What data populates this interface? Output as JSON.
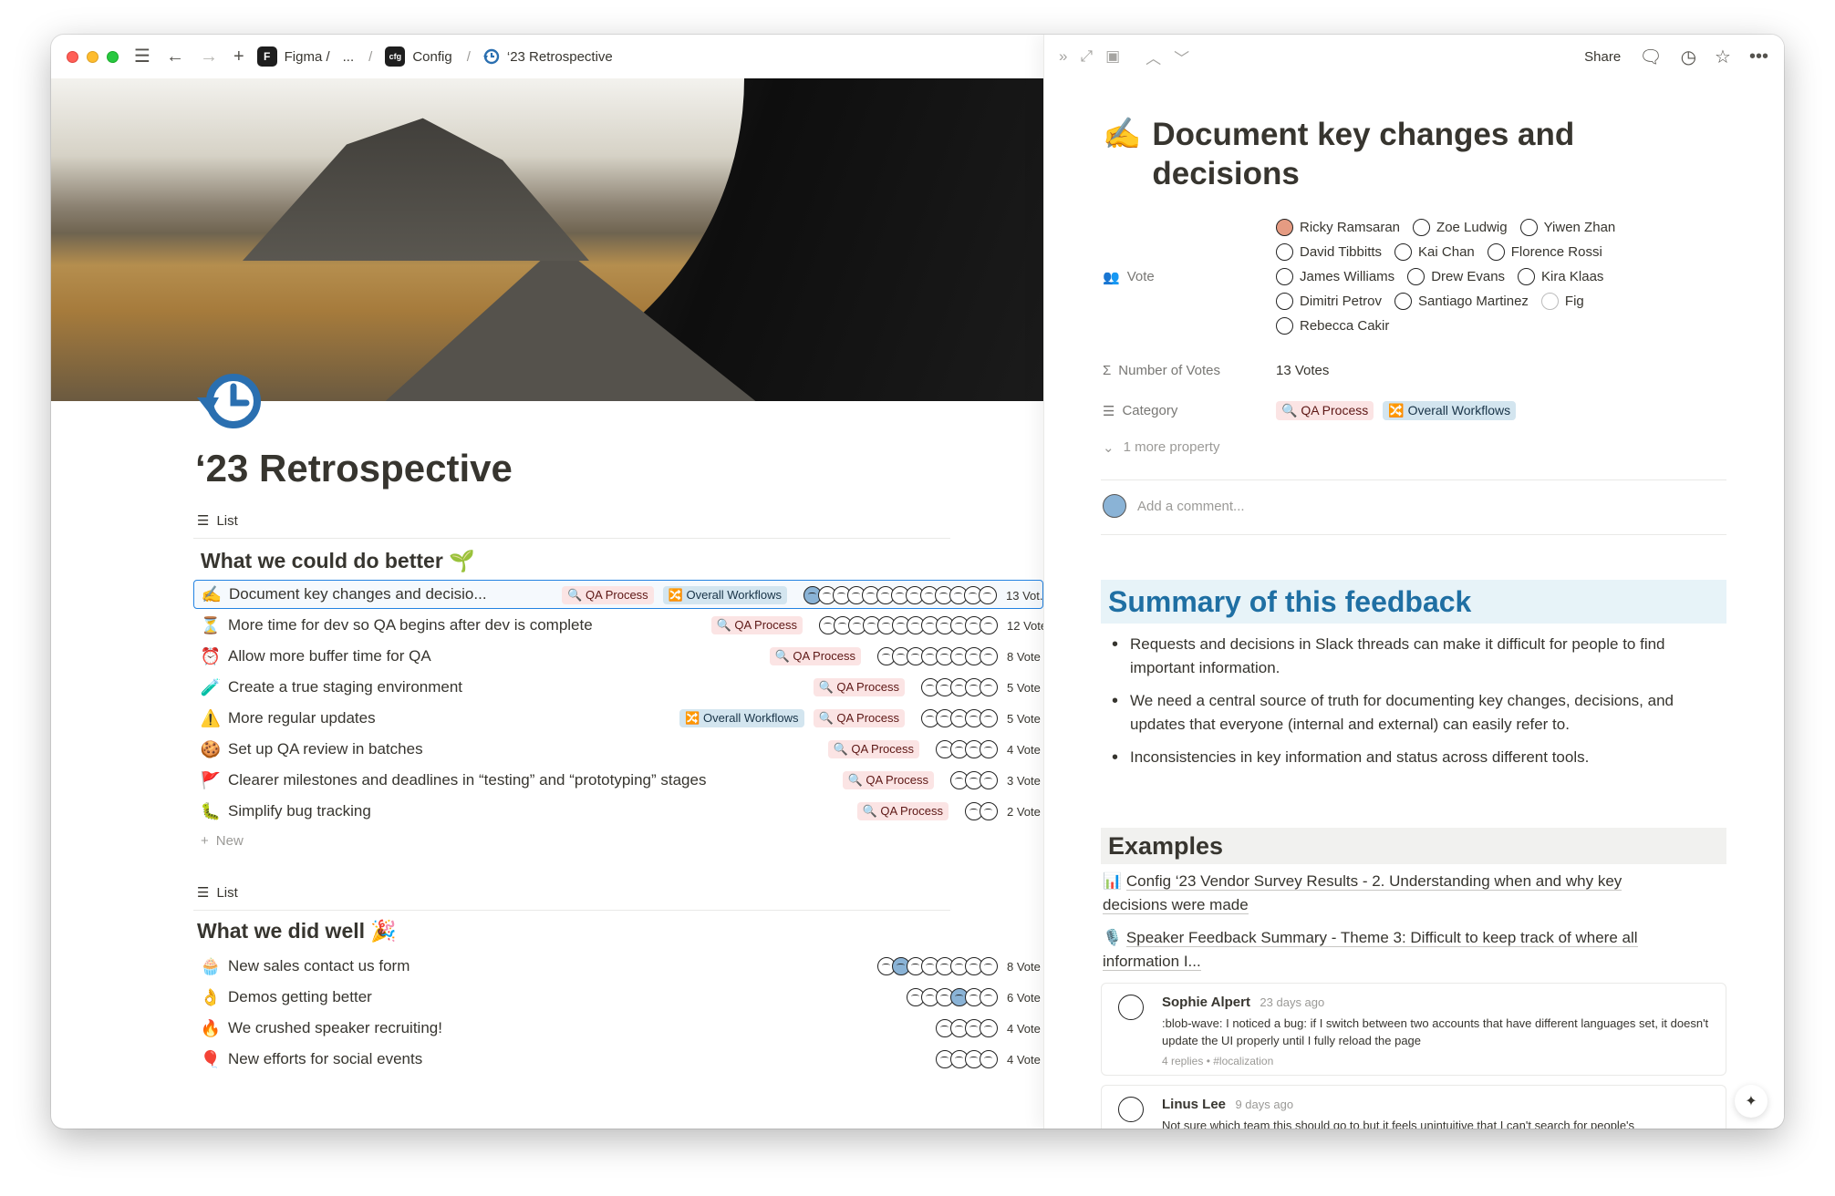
{
  "breadcrumbs": [
    {
      "label": "Figma /",
      "icon": "figma-logo"
    },
    {
      "label": "...",
      "icon": ""
    },
    {
      "label": "Config",
      "icon": "config-logo"
    },
    {
      "label": "‘23 Retrospective",
      "icon": "retro-icon"
    }
  ],
  "page": {
    "title": "‘23 Retrospective",
    "view_label": "List"
  },
  "groups": [
    {
      "title": "What we could do better 🌱",
      "rows": [
        {
          "emoji": "✍️",
          "title": "Document key changes and decisio...",
          "tags": [
            "🔍 QA Process",
            "🔀 Overall Workflows"
          ],
          "votes": "13 Vot..."
        },
        {
          "emoji": "⏳",
          "title": "More time for dev so QA begins after dev is complete",
          "tags": [
            "🔍 QA Process"
          ],
          "votes": "12 Vote"
        },
        {
          "emoji": "⏰",
          "title": "Allow more buffer time for QA",
          "tags": [
            "🔍 QA Process"
          ],
          "votes": "8 Vote"
        },
        {
          "emoji": "🧪",
          "title": "Create a true staging environment",
          "tags": [
            "🔍 QA Process"
          ],
          "votes": "5 Vote"
        },
        {
          "emoji": "⚠️",
          "title": "More regular updates",
          "tags": [
            "🔀 Overall Workflows",
            "🔍 QA Process"
          ],
          "votes": "5 Vote"
        },
        {
          "emoji": "🍪",
          "title": "Set up QA review in batches",
          "tags": [
            "🔍 QA Process"
          ],
          "votes": "4 Vote"
        },
        {
          "emoji": "🚩",
          "title": "Clearer milestones and deadlines in “testing” and “prototyping” stages",
          "tags": [
            "🔍 QA Process"
          ],
          "votes": "3 Vote"
        },
        {
          "emoji": "🐛",
          "title": "Simplify bug tracking",
          "tags": [
            "🔍 QA Process"
          ],
          "votes": "2 Vote"
        }
      ],
      "new_label": "New"
    },
    {
      "title": "What we did well 🎉",
      "rows": [
        {
          "emoji": "🧁",
          "title": "New sales contact us form",
          "tags": [],
          "votes": "8 Vote"
        },
        {
          "emoji": "👌",
          "title": "Demos getting better",
          "tags": [],
          "votes": "6 Vote"
        },
        {
          "emoji": "🔥",
          "title": "We crushed speaker recruiting!",
          "tags": [],
          "votes": "4 Vote"
        },
        {
          "emoji": "🎈",
          "title": "New efforts for social events",
          "tags": [],
          "votes": "4 Vote"
        }
      ]
    }
  ],
  "peek": {
    "share_label": "Share",
    "title_emoji": "✍️",
    "title": "Document key changes and decisions",
    "vote_label": "Vote",
    "voters": [
      "Ricky Ramsaran",
      "Zoe Ludwig",
      "Yiwen Zhan",
      "David Tibbitts",
      "Kai Chan",
      "Florence Rossi",
      "James Williams",
      "Drew Evans",
      "Kira Klaas",
      "Dimitri Petrov",
      "Santiago Martinez",
      "Fig",
      "Rebecca Cakir"
    ],
    "num_votes_label": "Number of Votes",
    "num_votes": "13 Votes",
    "category_label": "Category",
    "categories": [
      "🔍 QA Process",
      "🔀 Overall Workflows"
    ],
    "more_property": "1 more property",
    "add_comment": "Add a comment...",
    "summary_heading": "Summary of this feedback",
    "summary_points": [
      "Requests and decisions in Slack threads can make it difficult for people to find important information.",
      "We need a central source of truth for documenting key changes, decisions, and updates that everyone (internal and external) can easily refer to.",
      "Inconsistencies in key information and status across different tools."
    ],
    "examples_heading": "Examples",
    "example_links": [
      {
        "emoji": "📊",
        "text": "Config ‘23 Vendor Survey Results - 2. Understanding when and why key decisions were made"
      },
      {
        "emoji": "🎙️",
        "text": "Speaker Feedback Summary - Theme 3: Difficult to keep track of where all information I..."
      }
    ],
    "threads": [
      {
        "author": "Sophie Alpert",
        "time": "23 days ago",
        "body": ":blob-wave: I noticed a bug: if I switch between two accounts that have different languages set, it doesn't update the UI properly until I fully reload the page",
        "meta": "4 replies • #localization"
      },
      {
        "author": "Linus Lee",
        "time": "9 days ago",
        "body": "Not sure which team this should go to but it feels unintuitive that I can't search for people's"
      }
    ]
  },
  "colors": {
    "accent_blue": "#2383e2",
    "qa_tag_bg": "#fbe4e4",
    "workflow_tag_bg": "#d3e5ef",
    "summary_heading_color": "#1f6fa3",
    "summary_heading_bg": "#e7f3f8",
    "examples_heading_bg": "#f1f1ef"
  }
}
